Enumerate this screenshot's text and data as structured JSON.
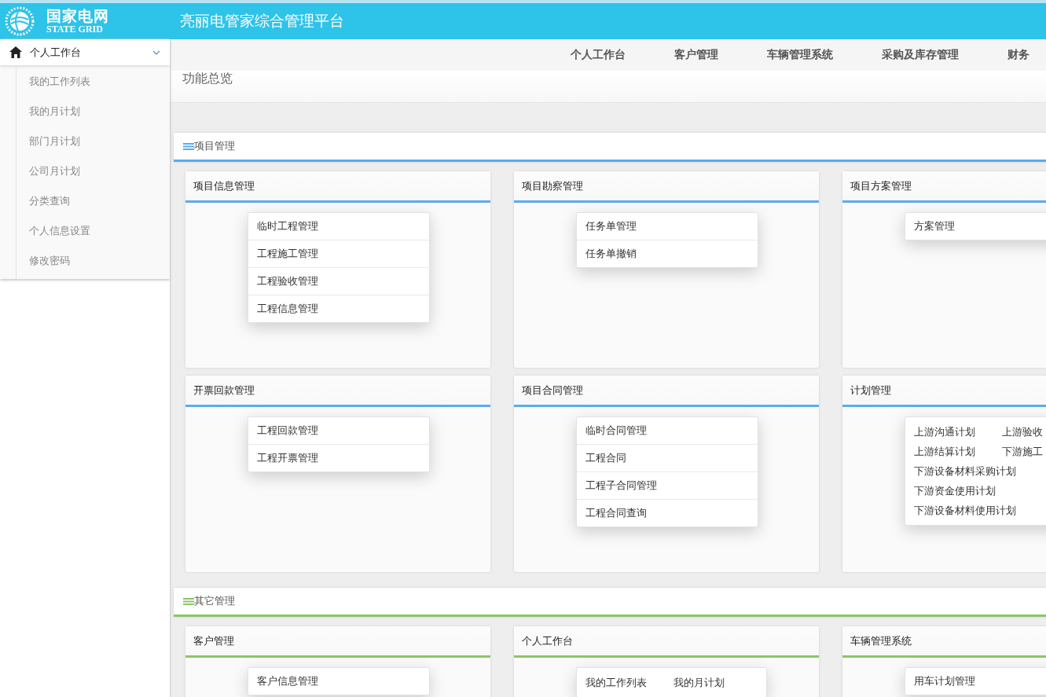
{
  "header": {
    "logo_cn": "国家电网",
    "logo_en": "STATE GRID",
    "title": "亮丽电管家综合管理平台"
  },
  "sidebar": {
    "group": {
      "label": "个人工作台",
      "expanded": true,
      "children": [
        "我的工作列表",
        "我的月计划",
        "部门月计划",
        "公司月计划",
        "分类查询",
        "个人信息设置",
        "修改密码"
      ]
    }
  },
  "nav": [
    "个人工作台",
    "客户管理",
    "车辆管理系统",
    "采购及库存管理",
    "财务"
  ],
  "page_title": "功能总览",
  "sections": [
    {
      "title": "项目管理",
      "color": "#5aabf0",
      "cards": [
        {
          "title": "项目信息管理",
          "kind": "list",
          "links": [
            "临时工程管理",
            "工程施工管理",
            "工程验收管理",
            "工程信息管理"
          ]
        },
        {
          "title": "项目勘察管理",
          "kind": "list",
          "links": [
            "任务单管理",
            "任务单撤销"
          ]
        },
        {
          "title": "项目方案管理",
          "kind": "list",
          "links": [
            "方案管理"
          ]
        },
        {
          "title": "开票回款管理",
          "kind": "list",
          "links": [
            "工程回款管理",
            "工程开票管理"
          ]
        },
        {
          "title": "项目合同管理",
          "kind": "list",
          "links": [
            "临时合同管理",
            "工程合同",
            "工程子合同管理",
            "工程合同查询"
          ]
        },
        {
          "title": "计划管理",
          "kind": "grid",
          "links": [
            "上游沟通计划",
            "上游验收",
            "上游结算计划",
            "下游施工",
            "下游设备材料采购计划",
            "下游资金使用计划",
            "下游设备材料使用计划"
          ]
        }
      ]
    },
    {
      "title": "其它管理",
      "color": "#8cc56a",
      "cards": [
        {
          "title": "客户管理",
          "kind": "list",
          "links": [
            "客户信息管理"
          ]
        },
        {
          "title": "个人工作台",
          "kind": "grid",
          "links": [
            "我的工作列表",
            "我的月计划"
          ]
        },
        {
          "title": "车辆管理系统",
          "kind": "list",
          "links": [
            "用车计划管理"
          ]
        }
      ]
    }
  ]
}
